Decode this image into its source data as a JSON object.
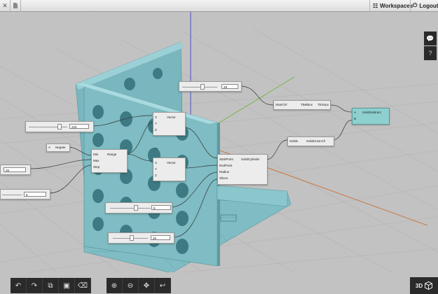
{
  "topbar": {
    "close_icon": "close-icon",
    "file_icon": "file-icon",
    "workspaces_label": "Workspaces",
    "logout_label": "Logout"
  },
  "nodes": {
    "vector1": {
      "title": "Vector",
      "ports": [
        "X",
        "Y",
        "Z"
      ]
    },
    "vector2": {
      "title": "Vector",
      "ports": [
        "X",
        "Y",
        "Z"
      ]
    },
    "range": {
      "title": "Range",
      "ports": [
        "Min",
        "Max",
        "Step"
      ]
    },
    "negate": {
      "title": "Negate",
      "ports": [
        "A"
      ]
    },
    "subtract": {
      "title": "TBelBox",
      "ports": [
        "StartCtrl",
        "TEnSpx"
      ]
    },
    "solid_subtract": {
      "title": "SolidSubtract",
      "ports": [
        "A",
        "B"
      ]
    },
    "solid_union": {
      "title": "SolidUnionAll",
      "ports": [
        "Solids"
      ]
    },
    "solid_cylinder": {
      "title": "SolidCylinder",
      "ports": [
        "StartPoint",
        "EndPoint",
        "Radius",
        "Slices"
      ]
    }
  },
  "sliders": {
    "s1": {
      "value": "28"
    },
    "s2": {
      "value": "220"
    },
    "s3": {
      "value": "25"
    },
    "s4": {
      "value": "8"
    },
    "s5": {
      "value": "8"
    },
    "s6": {
      "value": "20"
    }
  },
  "sidebar": {
    "chat_icon": "speech-bubble-icon",
    "help_label": "?"
  },
  "view_toggle_label": "3D",
  "colors": {
    "model": "#7fbcc3",
    "node_selected": "#8ecfcf",
    "background": "#c2c2c2",
    "toolbar": "#2a2a2a"
  }
}
